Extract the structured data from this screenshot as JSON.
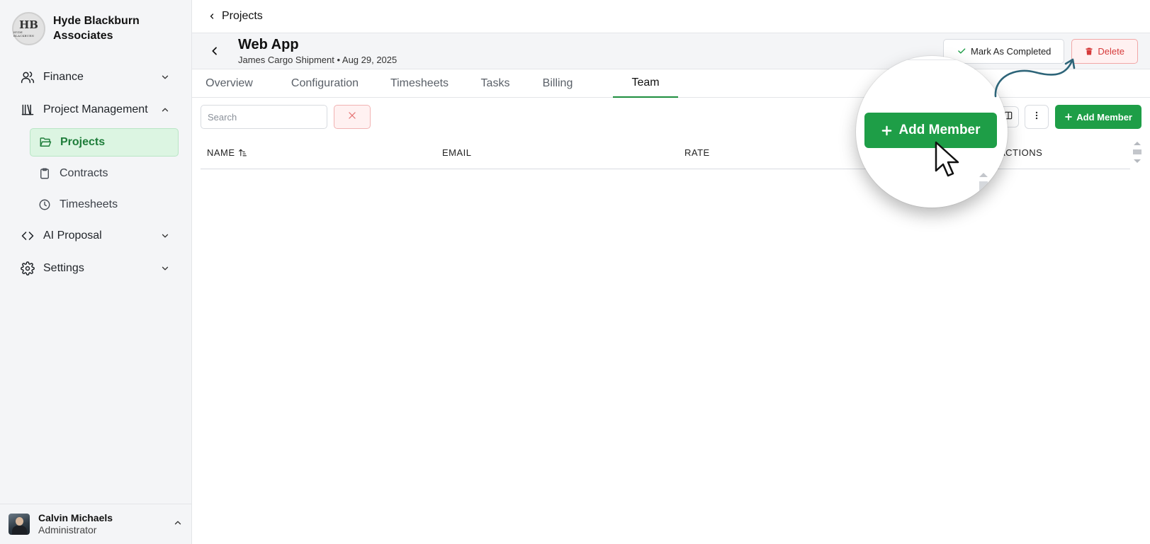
{
  "brand": {
    "name_line1": "Hyde Blackburn",
    "name_line2": "Associates",
    "logo_mono": "HB",
    "logo_text": "HYDE BLACKBURN"
  },
  "sidebar": {
    "finance": "Finance",
    "project_management": "Project Management",
    "projects": "Projects",
    "contracts": "Contracts",
    "timesheets": "Timesheets",
    "ai_proposal": "AI Proposal",
    "settings": "Settings"
  },
  "user": {
    "name": "Calvin Michaels",
    "role": "Administrator"
  },
  "topbar": {
    "back_label": "Projects"
  },
  "header": {
    "title": "Web App",
    "subtitle": "James Cargo Shipment • Aug 29, 2025",
    "mark_completed": "Mark As Completed",
    "delete": "Delete"
  },
  "tabs": [
    "Overview",
    "Configuration",
    "Timesheets",
    "Tasks",
    "Billing",
    "Team"
  ],
  "active_tab": "Team",
  "toolbar": {
    "search_placeholder": "Search",
    "add_member": "Add Member"
  },
  "table": {
    "columns": [
      "NAME",
      "EMAIL",
      "RATE",
      "ACTIONS"
    ]
  },
  "callout": {
    "add_member": "Add Member"
  },
  "colors": {
    "primary": "#1e9e47",
    "danger": "#d63a3a",
    "active_nav_bg": "#dcf5e2"
  }
}
